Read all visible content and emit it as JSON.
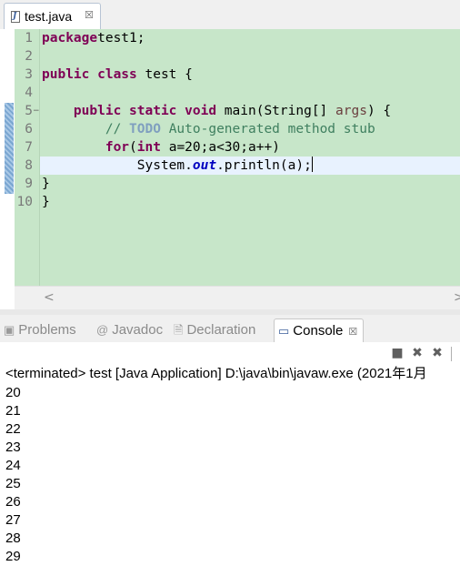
{
  "editor": {
    "tab_label": "test.java",
    "tab_close": "☒",
    "file_icon_letter": "J",
    "code_lines": [
      {
        "no": "1"
      },
      {
        "no": "2"
      },
      {
        "no": "3"
      },
      {
        "no": "4"
      },
      {
        "no": "5"
      },
      {
        "no": "6"
      },
      {
        "no": "7"
      },
      {
        "no": "8"
      },
      {
        "no": "9"
      },
      {
        "no": "10"
      }
    ]
  },
  "views": {
    "tabs": [
      {
        "label": "Problems",
        "icon": "problems-icon"
      },
      {
        "label": "Javadoc",
        "icon": "javadoc-icon"
      },
      {
        "label": "Declaration",
        "icon": "declaration-icon"
      },
      {
        "label": "Console",
        "icon": "console-icon",
        "active": true
      }
    ],
    "close": "☒"
  },
  "console": {
    "header": "<terminated> test [Java Application] D:\\java\\bin\\javaw.exe (2021年1月",
    "output": [
      "20",
      "21",
      "22",
      "23",
      "24",
      "25",
      "26",
      "27",
      "28",
      "29"
    ]
  },
  "colors": {
    "editor_bg": "#c7e6c9",
    "current_line": "#e8f2fe",
    "keyword": "#7f0055",
    "comment": "#3f7f5f"
  }
}
